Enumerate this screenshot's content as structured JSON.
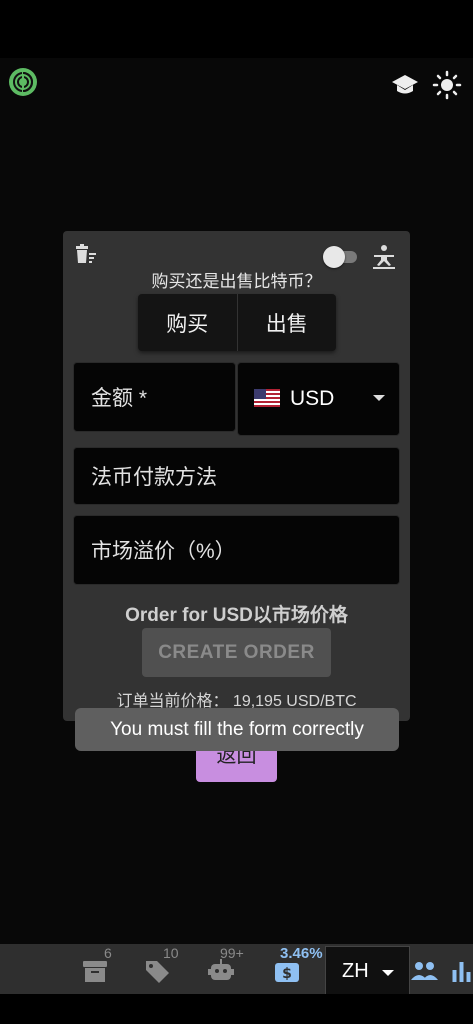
{
  "card": {
    "question": "购买还是出售比特币？",
    "buy_label": "购买",
    "sell_label": "出售",
    "amount_placeholder": "金额 *",
    "currency_code": "USD",
    "payment_placeholder": "法币付款方法",
    "premium_placeholder": "市场溢价（%）",
    "order_for_text": "Order for USD以市场价格",
    "create_order_label": "CREATE ORDER",
    "price_text": "订单当前价格： 19,195 USD/BTC"
  },
  "back_label": "返回",
  "toast_text": "You must fill the form correctly",
  "bottom_bar": {
    "archive_badge": "6",
    "tags_badge": "10",
    "robot_badge": "99+",
    "exchange_pct": "3.46%",
    "language": "ZH"
  },
  "icons": {
    "top_left": "tor-onion-icon",
    "top_right": [
      "school-icon",
      "sun-icon"
    ],
    "card": [
      "clear-icon",
      "swap-icon"
    ],
    "bottom": [
      "archive-icon",
      "tag-icon",
      "robot-icon",
      "exchange-icon",
      "people-icon",
      "bar-chart-icon"
    ]
  },
  "colors": {
    "tor_green": "#5dbb63",
    "back_button": "#c88ee0",
    "pct_blue": "#8fc0f2"
  }
}
